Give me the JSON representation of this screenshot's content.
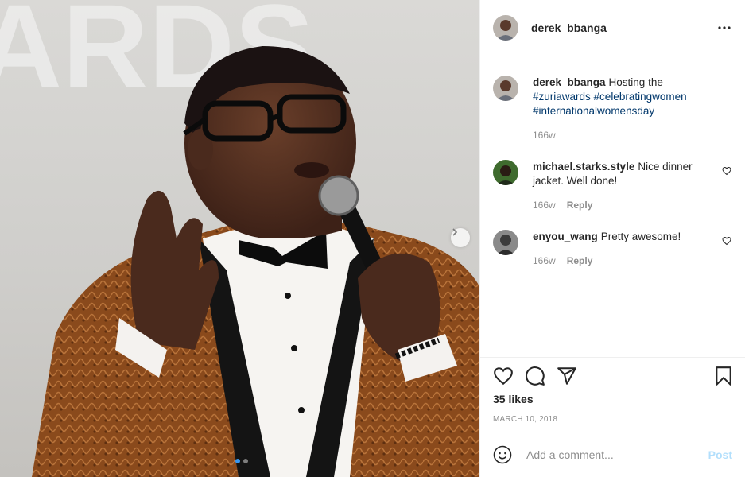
{
  "photo": {
    "background_text": "ARDS",
    "next_icon": "chevron-right-icon",
    "carousel": {
      "count": 2,
      "active": 1
    }
  },
  "header": {
    "username": "derek_bbanga",
    "more_icon": "more-options-icon"
  },
  "caption": {
    "username": "derek_bbanga",
    "text": "Hosting the",
    "hashtags": [
      "#zuriawards",
      "#celebratingwomen",
      "#internationalwomensday"
    ],
    "time": "166w"
  },
  "comments": [
    {
      "username": "michael.starks.style",
      "text": "Nice dinner jacket. Well done!",
      "time": "166w",
      "reply_label": "Reply"
    },
    {
      "username": "enyou_wang",
      "text": "Pretty awesome!",
      "time": "166w",
      "reply_label": "Reply"
    }
  ],
  "actions": {
    "like_icon": "heart-icon",
    "comment_icon": "comment-icon",
    "share_icon": "share-icon",
    "save_icon": "bookmark-icon",
    "likes": "35 likes",
    "date": "MARCH 10, 2018"
  },
  "add_comment": {
    "placeholder": "Add a comment...",
    "post_label": "Post",
    "emoji_icon": "emoji-icon"
  },
  "colors": {
    "hashtag": "#00376b",
    "post_button_disabled": "#b2dffc",
    "meta_text": "#8e8e8e",
    "jacket": "#8a4a1c"
  }
}
